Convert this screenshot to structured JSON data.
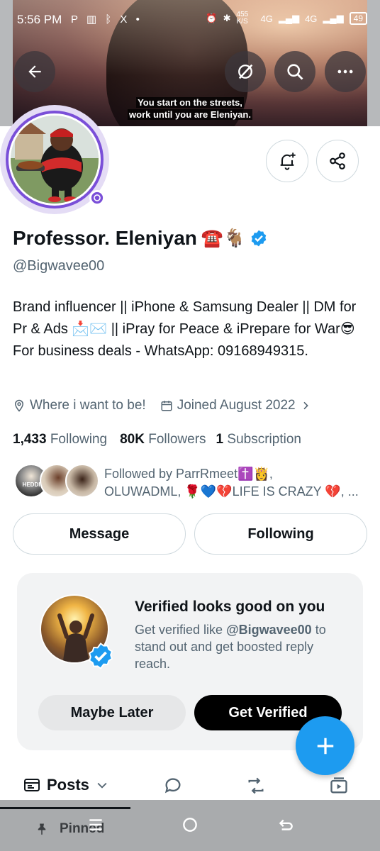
{
  "status_bar": {
    "time": "5:56 PM",
    "left_icons": "P ▥ ᛒ X •",
    "net_speed": "455 K/S",
    "net_type": "4G",
    "battery": "49"
  },
  "banner": {
    "caption_line1": "You start on the streets,",
    "caption_line2": "work until you are Eleniyan."
  },
  "profile": {
    "name": "Professor. Eleniyan",
    "name_emojis": "☎️🐐",
    "handle": "@Bigwavee00",
    "bio": "Brand influencer || iPhone & Samsung Dealer || DM for Pr & Ads 📩✉️ || iPray for Peace & iPrepare for War😎For business deals - WhatsApp: 09168949315.",
    "location": "Where i want to be!",
    "joined": "Joined August 2022",
    "following_count": "1,433",
    "following_label": "Following",
    "followers_count": "80K",
    "followers_label": "Followers",
    "subscription_count": "1",
    "subscription_label": "Subscription",
    "followed_by_line1": "Followed by ParrRmeet✝️👸,",
    "followed_by_line2": "OLUWADML, 🌹💙💔LIFE IS CRAZY 💔, ...",
    "follower_avatar_text": "HEDDI"
  },
  "actions": {
    "message": "Message",
    "following": "Following"
  },
  "verify_card": {
    "title": "Verified looks good on you",
    "desc_prefix": "Get verified like ",
    "desc_handle": "@Bigwavee00",
    "desc_suffix": " to stand out and get boosted reply reach.",
    "maybe_later": "Maybe Later",
    "get_verified": "Get Verified"
  },
  "tabs": {
    "posts": "Posts"
  },
  "pinned_label": "Pinned",
  "colors": {
    "accent": "#1d9bf0",
    "avatar_ring": "#7a4fd8",
    "text_primary": "#0f1419",
    "text_secondary": "#536471"
  }
}
